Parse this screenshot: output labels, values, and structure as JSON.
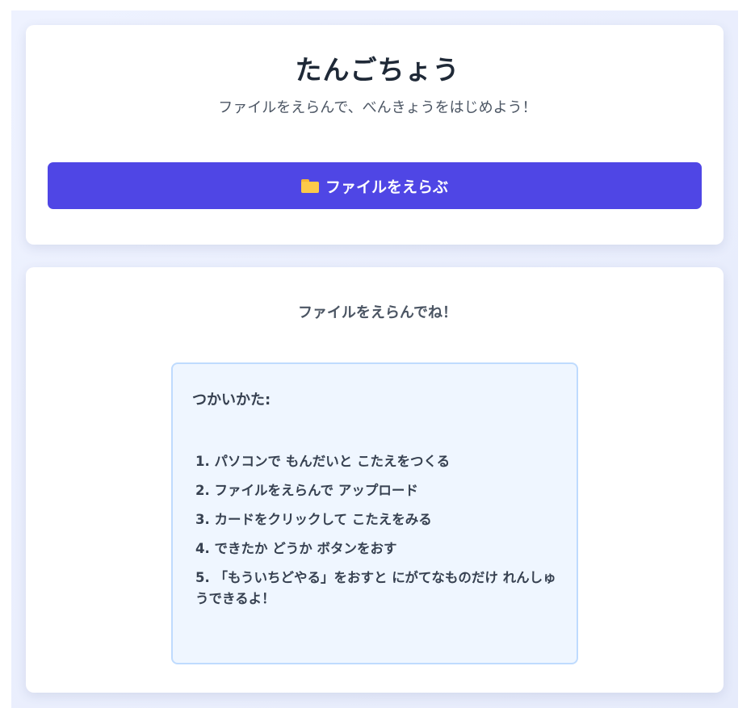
{
  "header": {
    "title": "たんごちょう",
    "subtitle": "ファイルをえらんで、べんきょうをはじめよう！",
    "upload_button": {
      "icon": "folder-icon",
      "label": "ファイルをえらぶ"
    }
  },
  "main": {
    "prompt": "ファイルをえらんでね！",
    "howto": {
      "title": "つかいかた:",
      "steps": [
        "1. パソコンで もんだいと こたえをつくる",
        "2. ファイルをえらんで アップロード",
        "3. カードをクリックして こたえをみる",
        "4. できたか どうか ボタンをおす",
        "5. 「もういちどやる」をおすと にがてなものだけ れんしゅうできるよ！"
      ]
    }
  },
  "colors": {
    "accent": "#4f46e5",
    "background": "#eef2ff",
    "card": "#ffffff",
    "howto_bg": "#eff6ff",
    "howto_border": "#bfdbfe"
  }
}
